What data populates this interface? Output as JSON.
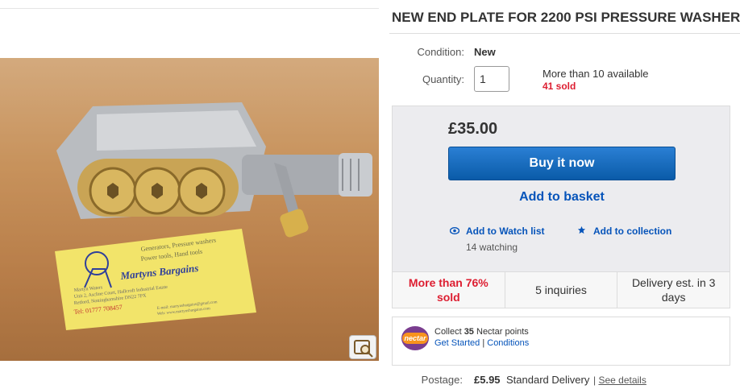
{
  "listing": {
    "title": "NEW END PLATE FOR 2200 PSI PRESSURE WASHER PUMP",
    "condition_label": "Condition:",
    "condition_value": "New",
    "quantity_label": "Quantity:",
    "quantity_value": "1",
    "availability": "More than 10 available",
    "sold": "41 sold"
  },
  "buybox": {
    "price": "£35.00",
    "buy_now": "Buy it now",
    "add_to_basket": "Add to basket",
    "watch_list": "Add to Watch list",
    "watching": "14 watching",
    "collection": "Add to collection",
    "stats": [
      "More than 76% sold",
      "5 inquiries",
      "Delivery est. in 3 days"
    ]
  },
  "nectar": {
    "logo": "nectar",
    "collect_prefix": "Collect",
    "points": "35",
    "collect_suffix": "Nectar points",
    "get_started": "Get Started",
    "separator": "|",
    "conditions": "Conditions"
  },
  "postage": {
    "label": "Postage:",
    "price": "£5.95",
    "method": "Standard Delivery",
    "separator": "|",
    "details": "See details"
  },
  "photo": {
    "card_line1": "Generators, Pressure washers",
    "card_line2": "Power tools, Hand tools",
    "card_brand": "Martyns Bargains",
    "card_name": "Martyn Waters",
    "card_addr1": "Unit 2, Ascline Court, Hallcroft Industrial Estate",
    "card_addr2": "Retford, Nottinghamshire DN22 7PX",
    "card_tel": "Tel: 01777 708457",
    "card_email": "E-mail: martynsbargains@gmail.com",
    "card_web": "Web: www.martynsbargains.com"
  },
  "colors": {
    "accent": "#0654ba",
    "sold_red": "#dd1e31",
    "buy_button": "#0a5ba8"
  },
  "icons": {
    "watch": "eye-icon",
    "collection": "star-icon",
    "zoom": "zoom-icon"
  }
}
